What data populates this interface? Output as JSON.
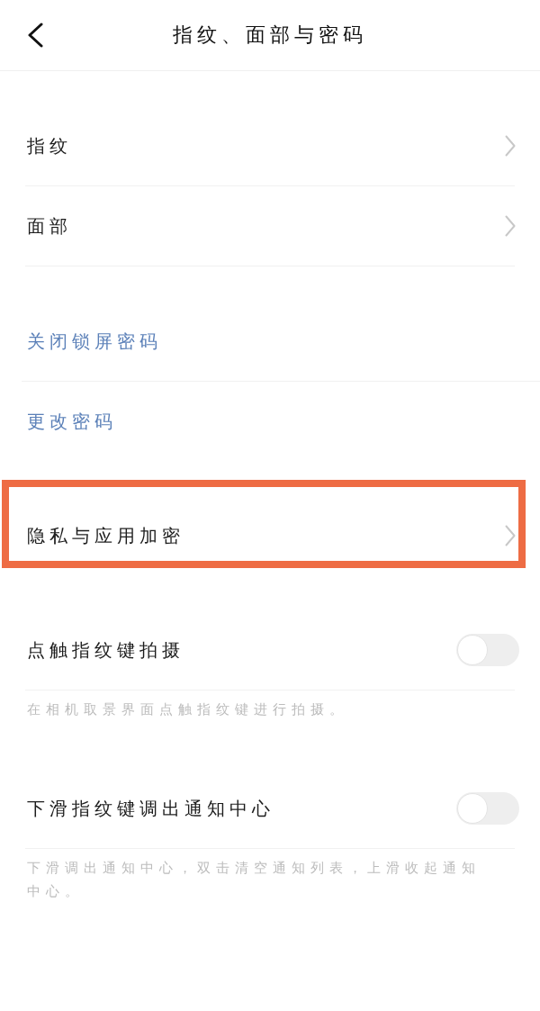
{
  "header": {
    "title": "指纹、面部与密码"
  },
  "sections": [
    {
      "items": [
        {
          "kind": "nav",
          "label": "指纹",
          "highlighted": false
        },
        {
          "kind": "nav",
          "label": "面部",
          "highlighted": false
        }
      ]
    },
    {
      "items": [
        {
          "kind": "action",
          "label": "关闭锁屏密码",
          "highlighted": false
        },
        {
          "kind": "action",
          "label": "更改密码",
          "highlighted": false
        }
      ]
    },
    {
      "items": [
        {
          "kind": "nav",
          "label": "隐私与应用加密",
          "highlighted": true
        }
      ]
    },
    {
      "items": [
        {
          "kind": "toggle",
          "label": "点触指纹键拍摄",
          "on": false,
          "description": "在相机取景界面点触指纹键进行拍摄。",
          "highlighted": false
        }
      ]
    },
    {
      "items": [
        {
          "kind": "toggle",
          "label": "下滑指纹键调出通知中心",
          "on": false,
          "description": "下滑调出通知中心，双击清空通知列表，上滑收起通知中心。",
          "highlighted": false
        }
      ]
    }
  ]
}
